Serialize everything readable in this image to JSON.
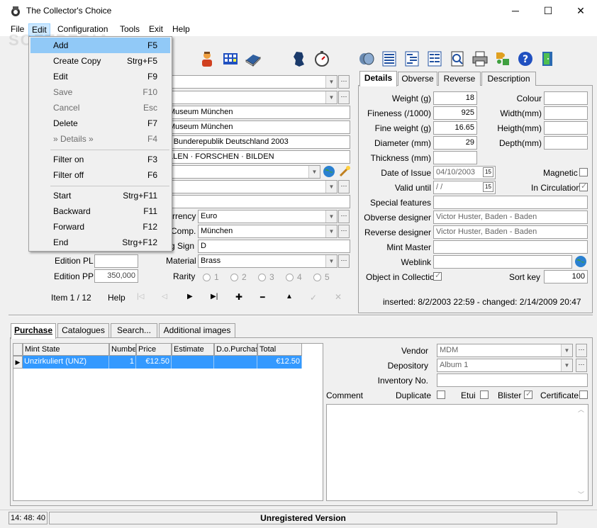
{
  "window": {
    "title": "The Collector's Choice",
    "controls": {
      "minimize": "─",
      "maximize": "☐",
      "close": "✕"
    }
  },
  "menubar": [
    "File",
    "Edit",
    "Configuration",
    "Tools",
    "Exit",
    "Help"
  ],
  "edit_menu": [
    {
      "label": "Add",
      "shortcut": "F5",
      "selected": true
    },
    {
      "label": "Create Copy",
      "shortcut": "Strg+F5"
    },
    {
      "label": "Edit",
      "shortcut": "F9"
    },
    {
      "label": "Save",
      "shortcut": "F10",
      "disabled": true
    },
    {
      "label": "Cancel",
      "shortcut": "Esc",
      "disabled": true
    },
    {
      "label": "Delete",
      "shortcut": "F7"
    },
    {
      "label": "» Details »",
      "shortcut": "F4",
      "disabled": true
    },
    {
      "label": "Filter on",
      "shortcut": "F3"
    },
    {
      "label": "Filter off",
      "shortcut": "F6"
    },
    {
      "label": "Start",
      "shortcut": "Strg+F11"
    },
    {
      "label": "Backward",
      "shortcut": "F11"
    },
    {
      "label": "Forward",
      "shortcut": "F12"
    },
    {
      "label": "End",
      "shortcut": "Strg+F12"
    }
  ],
  "watermark": "SOFTPEDIA",
  "left_form": {
    "field_museum1": "Museum München",
    "field_museum2": "Museum München",
    "field_country": "- Bunderepublik Deutschland 2003",
    "field_motto": "LLEN · FORSCHEN · BILDEN",
    "currency_label": "rrency",
    "currency_value": "Euro",
    "comp_label": "Comp.",
    "comp_value": "München",
    "mintsign_label": "g Sign",
    "mintsign_value": "D",
    "edition_pl_label": "Edition PL",
    "edition_pl_value": "",
    "material_label": "Material",
    "material_value": "Brass",
    "edition_pp_label": "Edition PP",
    "edition_pp_value": "350,000",
    "rarity_label": "Rarity",
    "rarity_options": [
      "1",
      "2",
      "3",
      "4",
      "5"
    ],
    "item_counter": "Item 1 / 12",
    "help_label": "Help",
    "nav_glyphs": [
      "|◁",
      "◁",
      "▶",
      "▶|",
      "✚",
      "━",
      "▲",
      "✓",
      "✕"
    ]
  },
  "details_tabs": [
    "Details",
    "Obverse",
    "Reverse",
    "Description"
  ],
  "details": {
    "weight_label": "Weight (g)",
    "weight": "18",
    "fineness_label": "Fineness (/1000)",
    "fineness": "925",
    "fineweight_label": "Fine weight (g)",
    "fineweight": "16.65",
    "diameter_label": "Diameter (mm)",
    "diameter": "29",
    "thickness_label": "Thickness (mm)",
    "thickness": "",
    "colour_label": "Colour",
    "colour": "",
    "width_label": "Width(mm)",
    "width": "",
    "height_label": "Heigth(mm)",
    "height": "",
    "depth_label": "Depth(mm)",
    "depth": "",
    "issue_label": "Date of Issue",
    "issue": "04/10/2003",
    "valid_label": "Valid until",
    "valid": " /  / ",
    "cal_glyph": "15",
    "magnetic_label": "Magnetic",
    "circulation_label": "In Circulation",
    "special_label": "Special features",
    "special": "",
    "obv_designer_label": "Obverse designer",
    "obv_designer": "Victor Huster, Baden - Baden",
    "rev_designer_label": "Reverse designer",
    "rev_designer": "Victor Huster, Baden - Baden",
    "mint_master_label": "Mint Master",
    "mint_master": "",
    "weblink_label": "Weblink",
    "weblink": "",
    "in_collection_label": "Object in Collection",
    "sortkey_label": "Sort key",
    "sortkey": "100",
    "timestamps": "inserted: 8/2/2003 22:59 - changed: 2/14/2009 20:47"
  },
  "bottom_tabs": [
    "Purchase",
    "Catalogues",
    "Search...",
    "Additional images"
  ],
  "purchase_grid": {
    "columns": [
      "Mint State",
      "Numbe",
      "Price",
      "Estimate",
      "D.o.Purchas",
      "Total"
    ],
    "rows": [
      [
        "Unzirkuliert (UNZ)",
        "1",
        "€12.50",
        "",
        "",
        "€12.50"
      ]
    ]
  },
  "purchase_form": {
    "vendor_label": "Vendor",
    "vendor": "MDM",
    "depository_label": "Depository",
    "depository": "Album 1",
    "inventory_label": "Inventory No.",
    "inventory": "",
    "comment_label": "Comment",
    "duplicate_label": "Duplicate",
    "etui_label": "Etui",
    "blister_label": "Blister",
    "certificate_label": "Certificate"
  },
  "statusbar": {
    "time": "14: 48: 40",
    "registration": "Unregistered Version"
  }
}
